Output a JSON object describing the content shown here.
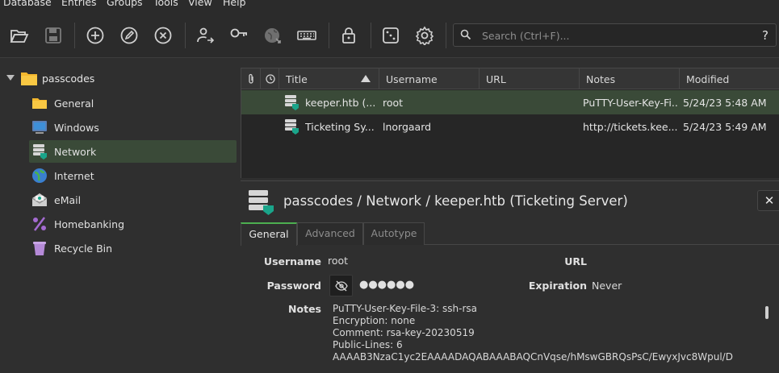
{
  "menu": [
    "Database",
    "Entries",
    "Groups",
    "Tools",
    "View",
    "Help"
  ],
  "toolbar": {
    "buttons": [
      "open-database",
      "save-database",
      "add-entry",
      "edit-entry",
      "delete-entry",
      "transfer-entry",
      "password-generator",
      "webbrowser",
      "autotype-keyboard",
      "lock-database",
      "dice",
      "settings"
    ]
  },
  "search": {
    "placeholder": "Search (Ctrl+F)...",
    "help": "?"
  },
  "tree": {
    "root": "passcodes",
    "groups": [
      {
        "label": "General",
        "icon": "folder-icon"
      },
      {
        "label": "Windows",
        "icon": "windows-icon"
      },
      {
        "label": "Network",
        "icon": "server-icon",
        "selected": true
      },
      {
        "label": "Internet",
        "icon": "globe-icon"
      },
      {
        "label": "eMail",
        "icon": "email-icon"
      },
      {
        "label": "Homebanking",
        "icon": "percent-icon"
      },
      {
        "label": "Recycle Bin",
        "icon": "recycle-bin-icon"
      }
    ]
  },
  "table": {
    "columns": [
      "Title",
      "Username",
      "URL",
      "Notes",
      "Modified"
    ],
    "rows": [
      {
        "title": "keeper.htb (...",
        "username": "root",
        "url": "",
        "notes": "PuTTY-User-Key-Fi...",
        "modified": "5/24/23 5:48 AM",
        "selected": true
      },
      {
        "title": "Ticketing Sy...",
        "username": "lnorgaard",
        "url": "",
        "notes": "http://tickets.kee...",
        "modified": "5/24/23 5:49 AM"
      }
    ]
  },
  "preview": {
    "title": "passcodes / Network / keeper.htb (Ticketing Server)",
    "close": "✕",
    "tabs": [
      "General",
      "Advanced",
      "Autotype"
    ],
    "fields": {
      "username_label": "Username",
      "username": "root",
      "password_label": "Password",
      "password": "●●●●●●",
      "url_label": "URL",
      "url": "",
      "expiration_label": "Expiration",
      "expiration": "Never",
      "notes_label": "Notes",
      "notes": "PuTTY-User-Key-File-3: ssh-rsa\nEncryption: none\nComment: rsa-key-20230519\nPublic-Lines: 6\nAAAAB3NzaC1yc2EAAAADAQABAAABAQCnVqse/hMswGBRQsPsC/EwyxJvc8Wpul/D"
    }
  },
  "colors": {
    "selection": "#3a4a38",
    "accent": "#4caf50",
    "folder": "#f5b82e",
    "entry_teal": "#1aa58a"
  }
}
